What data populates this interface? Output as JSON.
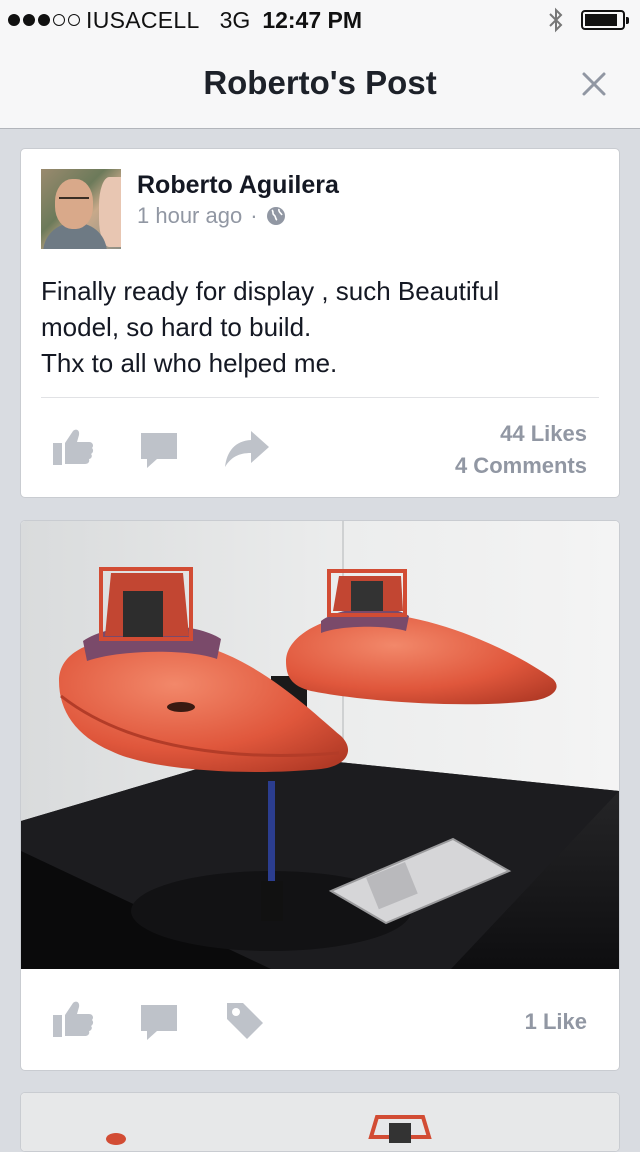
{
  "status_bar": {
    "carrier": "IUSACELL",
    "network": "3G",
    "time": "12:47 PM",
    "signal_bars_filled": 3,
    "signal_bars_total": 5,
    "battery_level": 0.9
  },
  "nav": {
    "title": "Roberto's Post",
    "close_icon": "close-icon"
  },
  "post": {
    "author": "Roberto Aguilera",
    "time_ago": "1 hour ago",
    "separator": "·",
    "privacy_icon": "globe-icon",
    "text_lines": [
      "Finally ready for display , such Beautiful",
      "model, so hard to build.",
      "Thx to all who helped me."
    ],
    "likes": "44 Likes",
    "comments": "4 Comments",
    "actions": [
      "like-icon",
      "comment-icon",
      "share-icon"
    ]
  },
  "photo_post": {
    "likes": "1 Like",
    "actions": [
      "like-icon",
      "comment-icon",
      "tag-icon"
    ]
  },
  "colors": {
    "background": "#d9dce1",
    "icon_gray": "#bec2c9",
    "meta_gray": "#9197a3",
    "model_orange": "#e0573c"
  }
}
